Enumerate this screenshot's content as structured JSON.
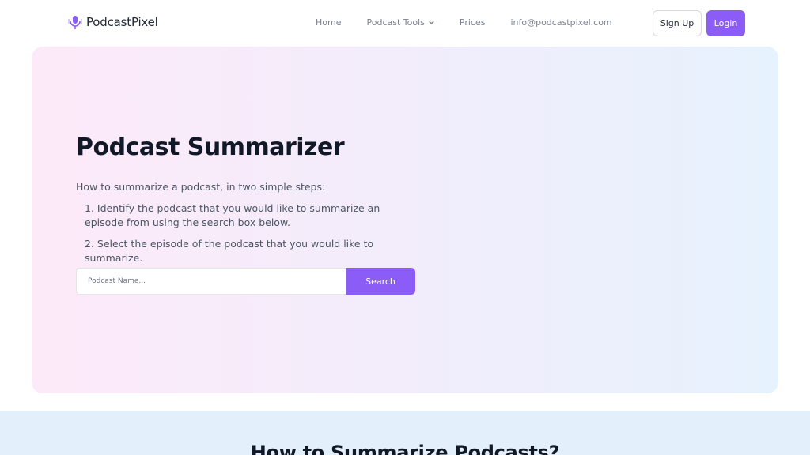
{
  "brand": {
    "name": "PodcastPixel",
    "icon": "podcast-microphone-icon",
    "accent_color": "#8b5cf6"
  },
  "nav": {
    "links": [
      {
        "label": "Home"
      },
      {
        "label": "Podcast Tools",
        "icon": "chevron-down-icon"
      },
      {
        "label": "Prices"
      },
      {
        "label": "info@podcastpixel.com"
      }
    ],
    "signup_label": "Sign Up",
    "login_label": "Login"
  },
  "hero": {
    "title": "Podcast Summarizer",
    "intro": "How to summarize a podcast, in two simple steps:",
    "steps": [
      "1. Identify the podcast that you would like to summarize an episode from using the search box below.",
      "2. Select the episode of the podcast that you would like to summarize."
    ],
    "search": {
      "placeholder": "Podcast Name...",
      "value": "",
      "button_label": "Search"
    },
    "gradient": [
      "#fdeaf9",
      "#e6f2fd"
    ]
  },
  "section2": {
    "title": "How to Summarize Podcasts?",
    "background": "#e3f0fb"
  }
}
